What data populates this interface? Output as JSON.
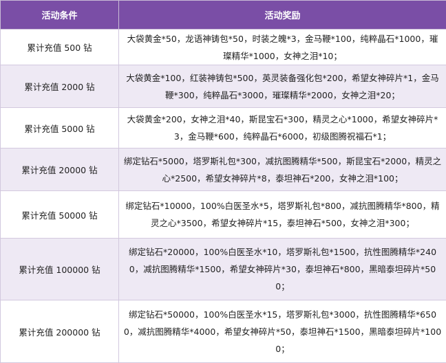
{
  "table": {
    "headers": {
      "condition": "活动条件",
      "reward": "活动奖励"
    },
    "rows": [
      {
        "condition": "累计充值 500 钻",
        "reward": "大袋黄金*50，龙语神铸包*50，时装之魄*3，金马鞭*100，纯粹晶石*1000，璀璨精华*1000，女神之泪*10；"
      },
      {
        "condition": "累计充值 2000 钻",
        "reward": "大袋黄金*100，红装神铸包*500，英灵装备强化包*200，希望女神碎片*1，金马鞭*300，纯粹晶石*3000，璀璨精华*2000，女神之泪*20；"
      },
      {
        "condition": "累计充值 5000 钻",
        "reward": "大袋黄金*200，女神之泪*40，斯昆宝石*300，精灵之心*1000，希望女神碎片*3，金马鞭*600，纯粹晶石*6000，初级图腾祝福石*1；"
      },
      {
        "condition": "累计充值 20000 钻",
        "reward": "绑定钻石*5000，塔罗斯礼包*300，减抗图腾精华*500，斯昆宝石*2000，精灵之心*2500，希望女神碎片*8，泰坦神石*200，女神之泪*100；"
      },
      {
        "condition": "累计充值 50000 钻",
        "reward": "绑定钻石*10000，100%白医圣水*5，塔罗斯礼包*800，减抗图腾精华*800，精灵之心*3500，希望女神碎片*15，泰坦神石*500，女神之泪*300；"
      },
      {
        "condition": "累计充值 100000 钻",
        "reward": "绑定钻石*20000，100%白医圣水*10，塔罗斯礼包*1500，抗性图腾精华*2400，减抗图腾精华*1500，希望女神碎片*30，泰坦神石*800，黑暗泰坦碎片*500；"
      },
      {
        "condition": "累计充值 200000 钻",
        "reward": "绑定钻石*50000，100%白医圣水*15，塔罗斯礼包*3000，抗性图腾精华*6500，减抗图腾精华*4000，希望女神碎片*50，泰坦神石*1500，黑暗泰坦碎片*1000；"
      }
    ]
  }
}
